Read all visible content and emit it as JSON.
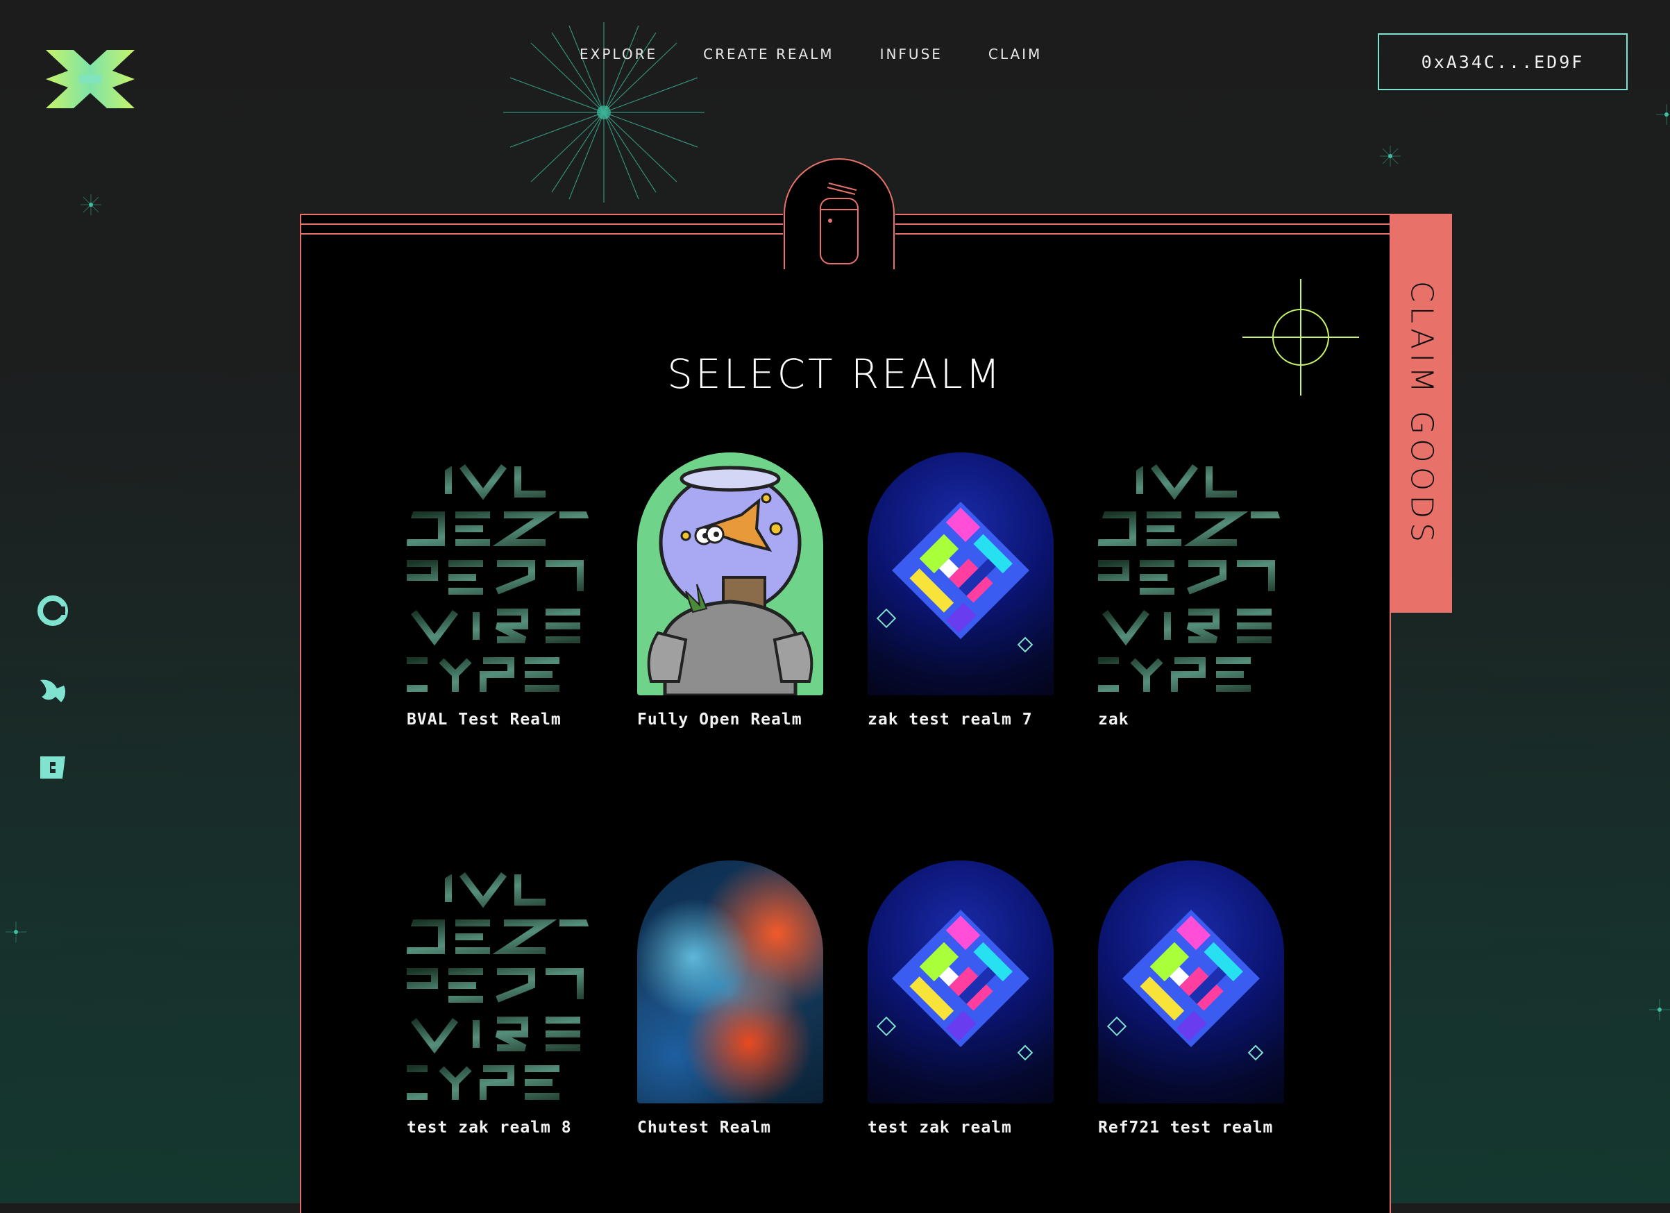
{
  "nav": {
    "items": [
      {
        "label": "EXPLORE"
      },
      {
        "label": "CREATE REALM"
      },
      {
        "label": "INFUSE"
      },
      {
        "label": "CLAIM"
      }
    ]
  },
  "wallet": {
    "address": "0xA34C...ED9F"
  },
  "panel": {
    "title": "SELECT REALM",
    "claim_tab_label": "CLAIM GOODS"
  },
  "realms": [
    {
      "name": "BVAL Test Realm",
      "art": "text-art"
    },
    {
      "name": "Fully Open Realm",
      "art": "fishbowl-knight"
    },
    {
      "name": "zak test realm 7",
      "art": "glitch-art"
    },
    {
      "name": "zak",
      "art": "text-art"
    },
    {
      "name": "test zak realm 8",
      "art": "text-art"
    },
    {
      "name": "Chutest Realm",
      "art": "smoke-art"
    },
    {
      "name": "test zak realm",
      "art": "glitch-art"
    },
    {
      "name": "Ref721 test realm",
      "art": "glitch-art"
    }
  ],
  "social": [
    {
      "icon": "coinbase-icon"
    },
    {
      "icon": "opensea-icon"
    },
    {
      "icon": "notes-icon"
    }
  ],
  "colors": {
    "accent_coral": "#e8726a",
    "accent_mint": "#7fe3cf",
    "accent_lime": "#c6f36a",
    "background": "#1c1c1c"
  }
}
